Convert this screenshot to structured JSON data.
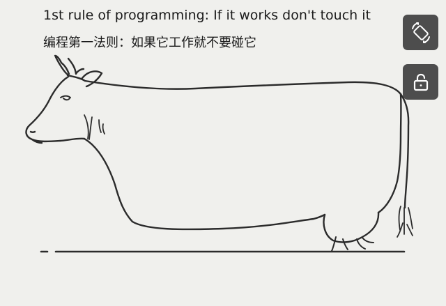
{
  "caption": {
    "english": "1st rule of programming: If it works don't touch it",
    "chinese": "编程第一法则：如果它工作就不要碰它"
  },
  "controls": {
    "rotate_icon": "rotate-screen-icon",
    "lock_icon": "unlock-icon",
    "button_color": "#4d4d4d",
    "icon_color": "#ffffff"
  }
}
